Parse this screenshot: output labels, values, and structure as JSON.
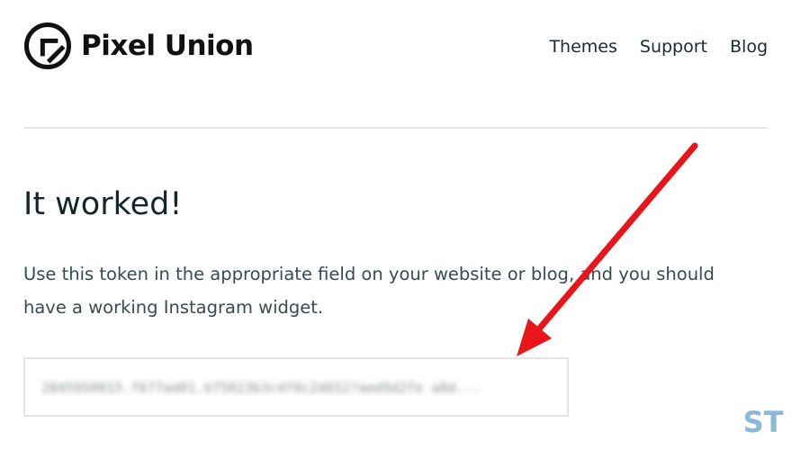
{
  "brand": {
    "name": "Pixel Union",
    "logo_icon": "pixel-union-logo-icon"
  },
  "nav": {
    "items": [
      "Themes",
      "Support",
      "Blog"
    ]
  },
  "main": {
    "title": "It worked!",
    "description": "Use this token in the appropriate field on your website or blog, and you should have a working Instagram widget.",
    "token_value": "2845950015.f677ad01.b75023b3c4f0c24652?aed9d2fe a0d..."
  },
  "annotation": {
    "arrow_color": "#e8161b",
    "arrow_icon": "red-arrow-icon"
  },
  "watermark": {
    "text": "ST",
    "color": "#8ab8d8"
  }
}
